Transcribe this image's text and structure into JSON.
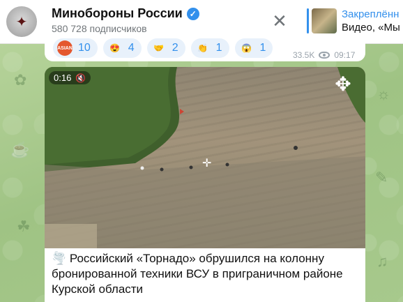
{
  "header": {
    "channel_name": "Минобороны России",
    "subscribers": "580 728 подписчиков",
    "pinned_title": "Закреплённ",
    "pinned_text": "Видео, «Мы"
  },
  "reactions": [
    {
      "emoji": "ASIAN",
      "count": "10",
      "color": "#e4572e"
    },
    {
      "emoji": "😍",
      "count": "4",
      "color": "#f6a33b"
    },
    {
      "emoji": "🤝",
      "count": "2",
      "color": "#f2b84b"
    },
    {
      "emoji": "👏",
      "count": "1",
      "color": "#f2c14e"
    },
    {
      "emoji": "😱",
      "count": "1",
      "color": "#f0b429"
    }
  ],
  "message_meta": {
    "views": "33.5K",
    "time": "09:17"
  },
  "video": {
    "duration": "0:16"
  },
  "caption": "🌪️ Российский «Торнадо» обрушился на колонну бронированной техники ВСУ в приграничном районе Курской области",
  "colors": {
    "accent": "#3390ec",
    "bubble": "#ffffff",
    "wallpaper": "#a9c98c"
  }
}
